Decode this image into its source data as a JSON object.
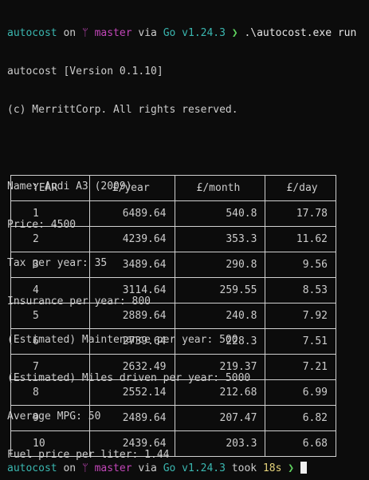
{
  "prompt": {
    "dir": "autocost",
    "on": " on ",
    "branch_icon": "git-branch-icon",
    "branch_glyph": "ᛘ",
    "branch": "master",
    "via": " via ",
    "lang_glyph": "Go",
    "version": "v1.24.3",
    "arrow": "❯",
    "command": ".\\autocost.exe run"
  },
  "output": {
    "header1": "autocost [Version 0.1.10]",
    "header2": "(c) MerrittCorp. All rights reserved.",
    "name": "Name: Audi A3 (2009)",
    "price": "Price: 4500",
    "tax": "Tax per year: 35",
    "insurance": "Insurance per year: 800",
    "maintenance": "(Estimated) Maintenance per year: 500",
    "miles": "(Estimated) Miles driven per year: 5000",
    "mpg": "Average MPG: 50",
    "fuel": "Fuel price per liter: 1.44"
  },
  "table": {
    "headers": [
      "YEAR",
      "£/year",
      "£/month",
      "£/day"
    ],
    "rows": [
      [
        "1",
        "6489.64",
        "540.8",
        "17.78"
      ],
      [
        "2",
        "4239.64",
        "353.3",
        "11.62"
      ],
      [
        "3",
        "3489.64",
        "290.8",
        "9.56"
      ],
      [
        "4",
        "3114.64",
        "259.55",
        "8.53"
      ],
      [
        "5",
        "2889.64",
        "240.8",
        "7.92"
      ],
      [
        "6",
        "2739.64",
        "228.3",
        "7.51"
      ],
      [
        "7",
        "2632.49",
        "219.37",
        "7.21"
      ],
      [
        "8",
        "2552.14",
        "212.68",
        "6.99"
      ],
      [
        "9",
        "2489.64",
        "207.47",
        "6.82"
      ],
      [
        "10",
        "2439.64",
        "203.3",
        "6.68"
      ]
    ]
  },
  "prompt_end": {
    "dir": "autocost",
    "on": " on ",
    "branch_glyph": "ᛘ",
    "branch": "master",
    "via": " via ",
    "lang_glyph": "Go",
    "version": "v1.24.3",
    "took": " took ",
    "duration": "18s",
    "arrow": "❯"
  },
  "colors": {
    "background": "#0c0c0c",
    "text": "#cccccc",
    "dir": "#3ab7b0",
    "branch": "#c246b8",
    "go": "#3ab7b0",
    "arrow": "#5fd35f",
    "duration": "#e5d37a"
  }
}
